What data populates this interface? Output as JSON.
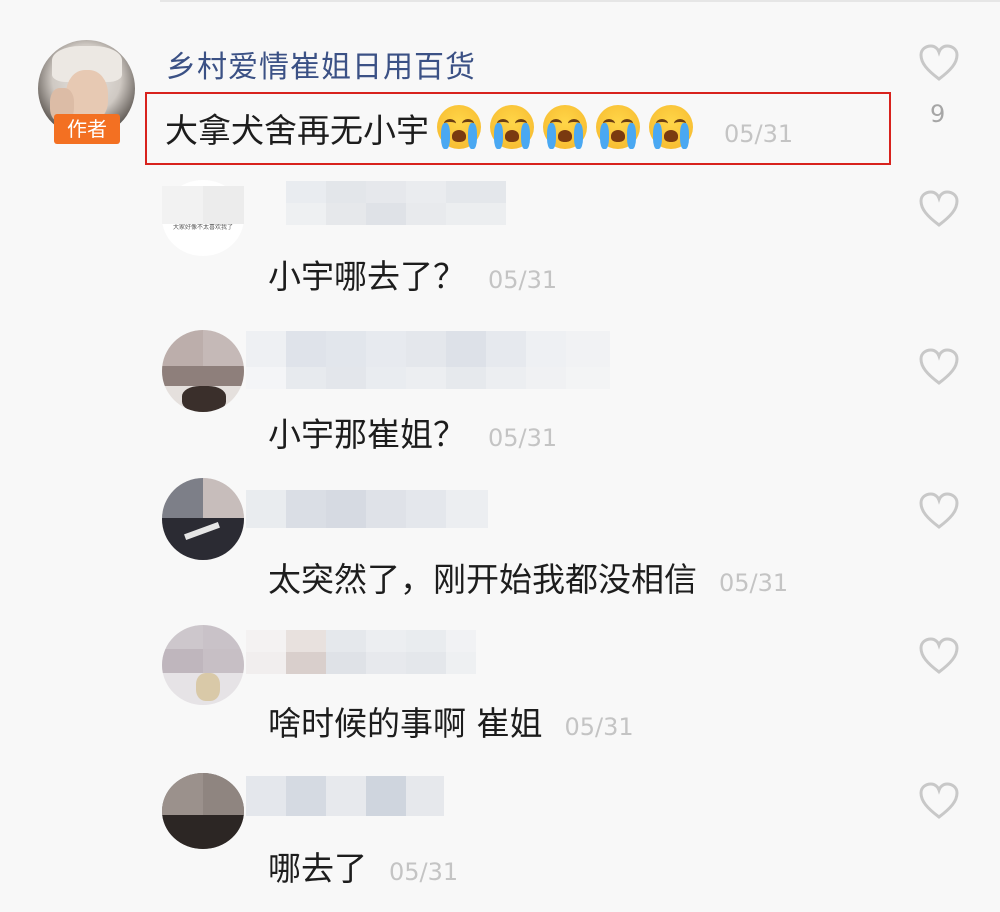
{
  "main_comment": {
    "username": "乡村爱情崔姐日用百货",
    "author_badge": "作者",
    "text": "大拿犬舍再无小宇",
    "emoji_name": "loudly-crying-face",
    "emoji_count": 5,
    "date": "05/31",
    "like_count": "9",
    "highlight_color": "#d8221d"
  },
  "replies": [
    {
      "avatar_caption": "大家好像不太喜欢我了",
      "text": "小宇哪去了？",
      "date": "05/31"
    },
    {
      "text": "小宇那崔姐？",
      "date": "05/31"
    },
    {
      "text": "太突然了，刚开始我都没相信",
      "date": "05/31"
    },
    {
      "text": "啥时候的事啊 崔姐",
      "date": "05/31"
    },
    {
      "text": "哪去了",
      "date": "05/31"
    }
  ],
  "colors": {
    "username": "#3b5185",
    "badge": "#f37022",
    "date": "#c4c4c4",
    "text": "#1d1d1d",
    "like_icon": "#c8c8c8"
  }
}
